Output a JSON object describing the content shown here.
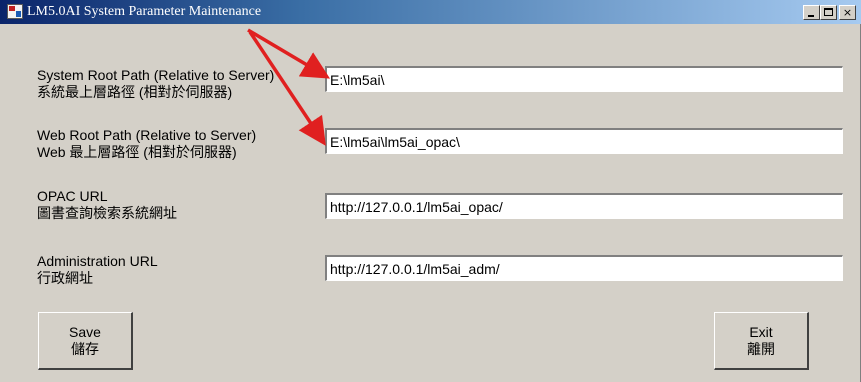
{
  "window": {
    "title": "LM5.0AI System Parameter Maintenance",
    "icon": "app-icon",
    "controls": {
      "minimize": "minimize-icon",
      "maximize": "maximize-icon",
      "close": "×"
    }
  },
  "fields": {
    "system_root": {
      "label_en": "System Root Path (Relative to Server)",
      "label_zh": "系統最上層路徑 (相對於伺服器)",
      "value": "E:\\lm5ai\\"
    },
    "web_root": {
      "label_en": "Web Root Path (Relative to Server)",
      "label_zh": "Web 最上層路徑 (相對於伺服器)",
      "value": "E:\\lm5ai\\lm5ai_opac\\"
    },
    "opac_url": {
      "label_en": "OPAC URL",
      "label_zh": "圖書查詢檢索系統網址",
      "value": "http://127.0.0.1/lm5ai_opac/"
    },
    "admin_url": {
      "label_en": "Administration URL",
      "label_zh": "行政網址",
      "value": "http://127.0.0.1/lm5ai_adm/"
    }
  },
  "buttons": {
    "save_en": "Save",
    "save_zh": "儲存",
    "exit_en": "Exit",
    "exit_zh": "離開"
  },
  "colors": {
    "dialog_face": "#d4d0c8",
    "title_gradient_start": "#0a246a",
    "title_gradient_end": "#a6caf0",
    "annotation_arrow": "#e02020"
  }
}
